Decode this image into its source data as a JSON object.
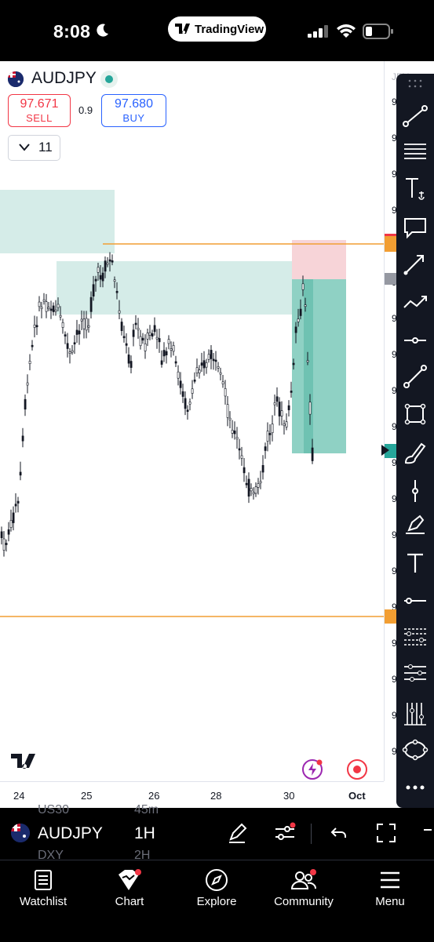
{
  "status_bar": {
    "time": "8:08",
    "app_pill": "TradingView"
  },
  "header": {
    "symbol": "AUDJPY",
    "sell_price": "97.671",
    "sell_label": "SELL",
    "buy_price": "97.680",
    "buy_label": "BUY",
    "spread": "0.9",
    "indicators_count": "11"
  },
  "price_axis": {
    "truncated_labels": [
      "9",
      "9",
      "9",
      "9",
      "9",
      "9",
      "9",
      "9",
      "9",
      "9",
      "9",
      "9",
      "9",
      "9",
      "9",
      "9",
      "9",
      "9",
      "9"
    ],
    "top_label": "JPY"
  },
  "time_axis": {
    "labels": [
      "24",
      "25",
      "26",
      "28",
      "30",
      "Oct"
    ]
  },
  "colors": {
    "accent_orange": "#f29e32",
    "zone_teal": "#d5ece8",
    "tp_teal": "#8fd1c4",
    "sl_pink": "#f7d4d8",
    "sell_red": "#f23645",
    "buy_blue": "#2962ff",
    "toolbar_bg": "#131722"
  },
  "drawing_tools": [
    "trend-line",
    "fib-retracement",
    "anchored-text",
    "callout",
    "arrow",
    "path",
    "horizontal-ray",
    "line-segment",
    "rectangle",
    "brush",
    "vertical-line",
    "highlighter",
    "text",
    "horizontal-line",
    "fib-channel",
    "pitchfork",
    "gann",
    "ellipse",
    "more"
  ],
  "bottom_toolbar": {
    "symbol": "AUDJPY",
    "interval": "1H",
    "ghost_top": [
      "US30",
      "45m"
    ],
    "ghost_bottom": [
      "DXY",
      "2H"
    ]
  },
  "nav": {
    "items": [
      {
        "label": "Watchlist",
        "icon": "watchlist-icon"
      },
      {
        "label": "Chart",
        "icon": "chart-icon"
      },
      {
        "label": "Explore",
        "icon": "compass-icon"
      },
      {
        "label": "Community",
        "icon": "community-icon"
      },
      {
        "label": "Menu",
        "icon": "menu-icon"
      }
    ]
  }
}
